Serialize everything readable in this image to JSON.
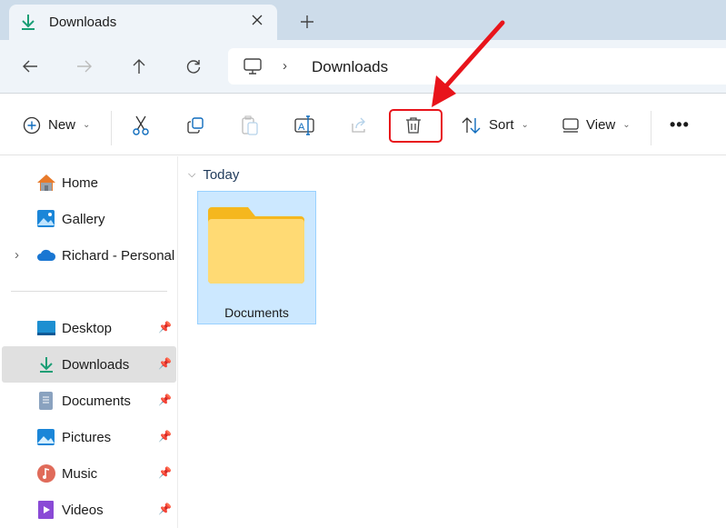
{
  "tab": {
    "title": "Downloads",
    "close_icon": "close-icon",
    "new_tab_icon": "plus-icon"
  },
  "nav": {
    "breadcrumb": [
      "This PC",
      "Downloads"
    ],
    "current": "Downloads"
  },
  "toolbar": {
    "new_label": "New",
    "sort_label": "Sort",
    "view_label": "View",
    "buttons": [
      "cut",
      "copy",
      "paste",
      "rename",
      "share",
      "delete"
    ]
  },
  "sidebar": {
    "items": [
      {
        "label": "Home",
        "icon": "home-icon"
      },
      {
        "label": "Gallery",
        "icon": "gallery-icon"
      },
      {
        "label": "Richard - Personal",
        "icon": "onedrive-icon"
      }
    ],
    "pinned": [
      {
        "label": "Desktop",
        "icon": "desktop-icon"
      },
      {
        "label": "Downloads",
        "icon": "download-icon",
        "selected": true
      },
      {
        "label": "Documents",
        "icon": "documents-icon"
      },
      {
        "label": "Pictures",
        "icon": "pictures-icon"
      },
      {
        "label": "Music",
        "icon": "music-icon"
      },
      {
        "label": "Videos",
        "icon": "videos-icon"
      }
    ]
  },
  "content": {
    "group": "Today",
    "items": [
      {
        "name": "Documents",
        "type": "folder",
        "selected": true
      }
    ]
  },
  "colors": {
    "accent": "#0f6cbd",
    "annotation": "#e8141b",
    "selection": "#cce8ff"
  }
}
